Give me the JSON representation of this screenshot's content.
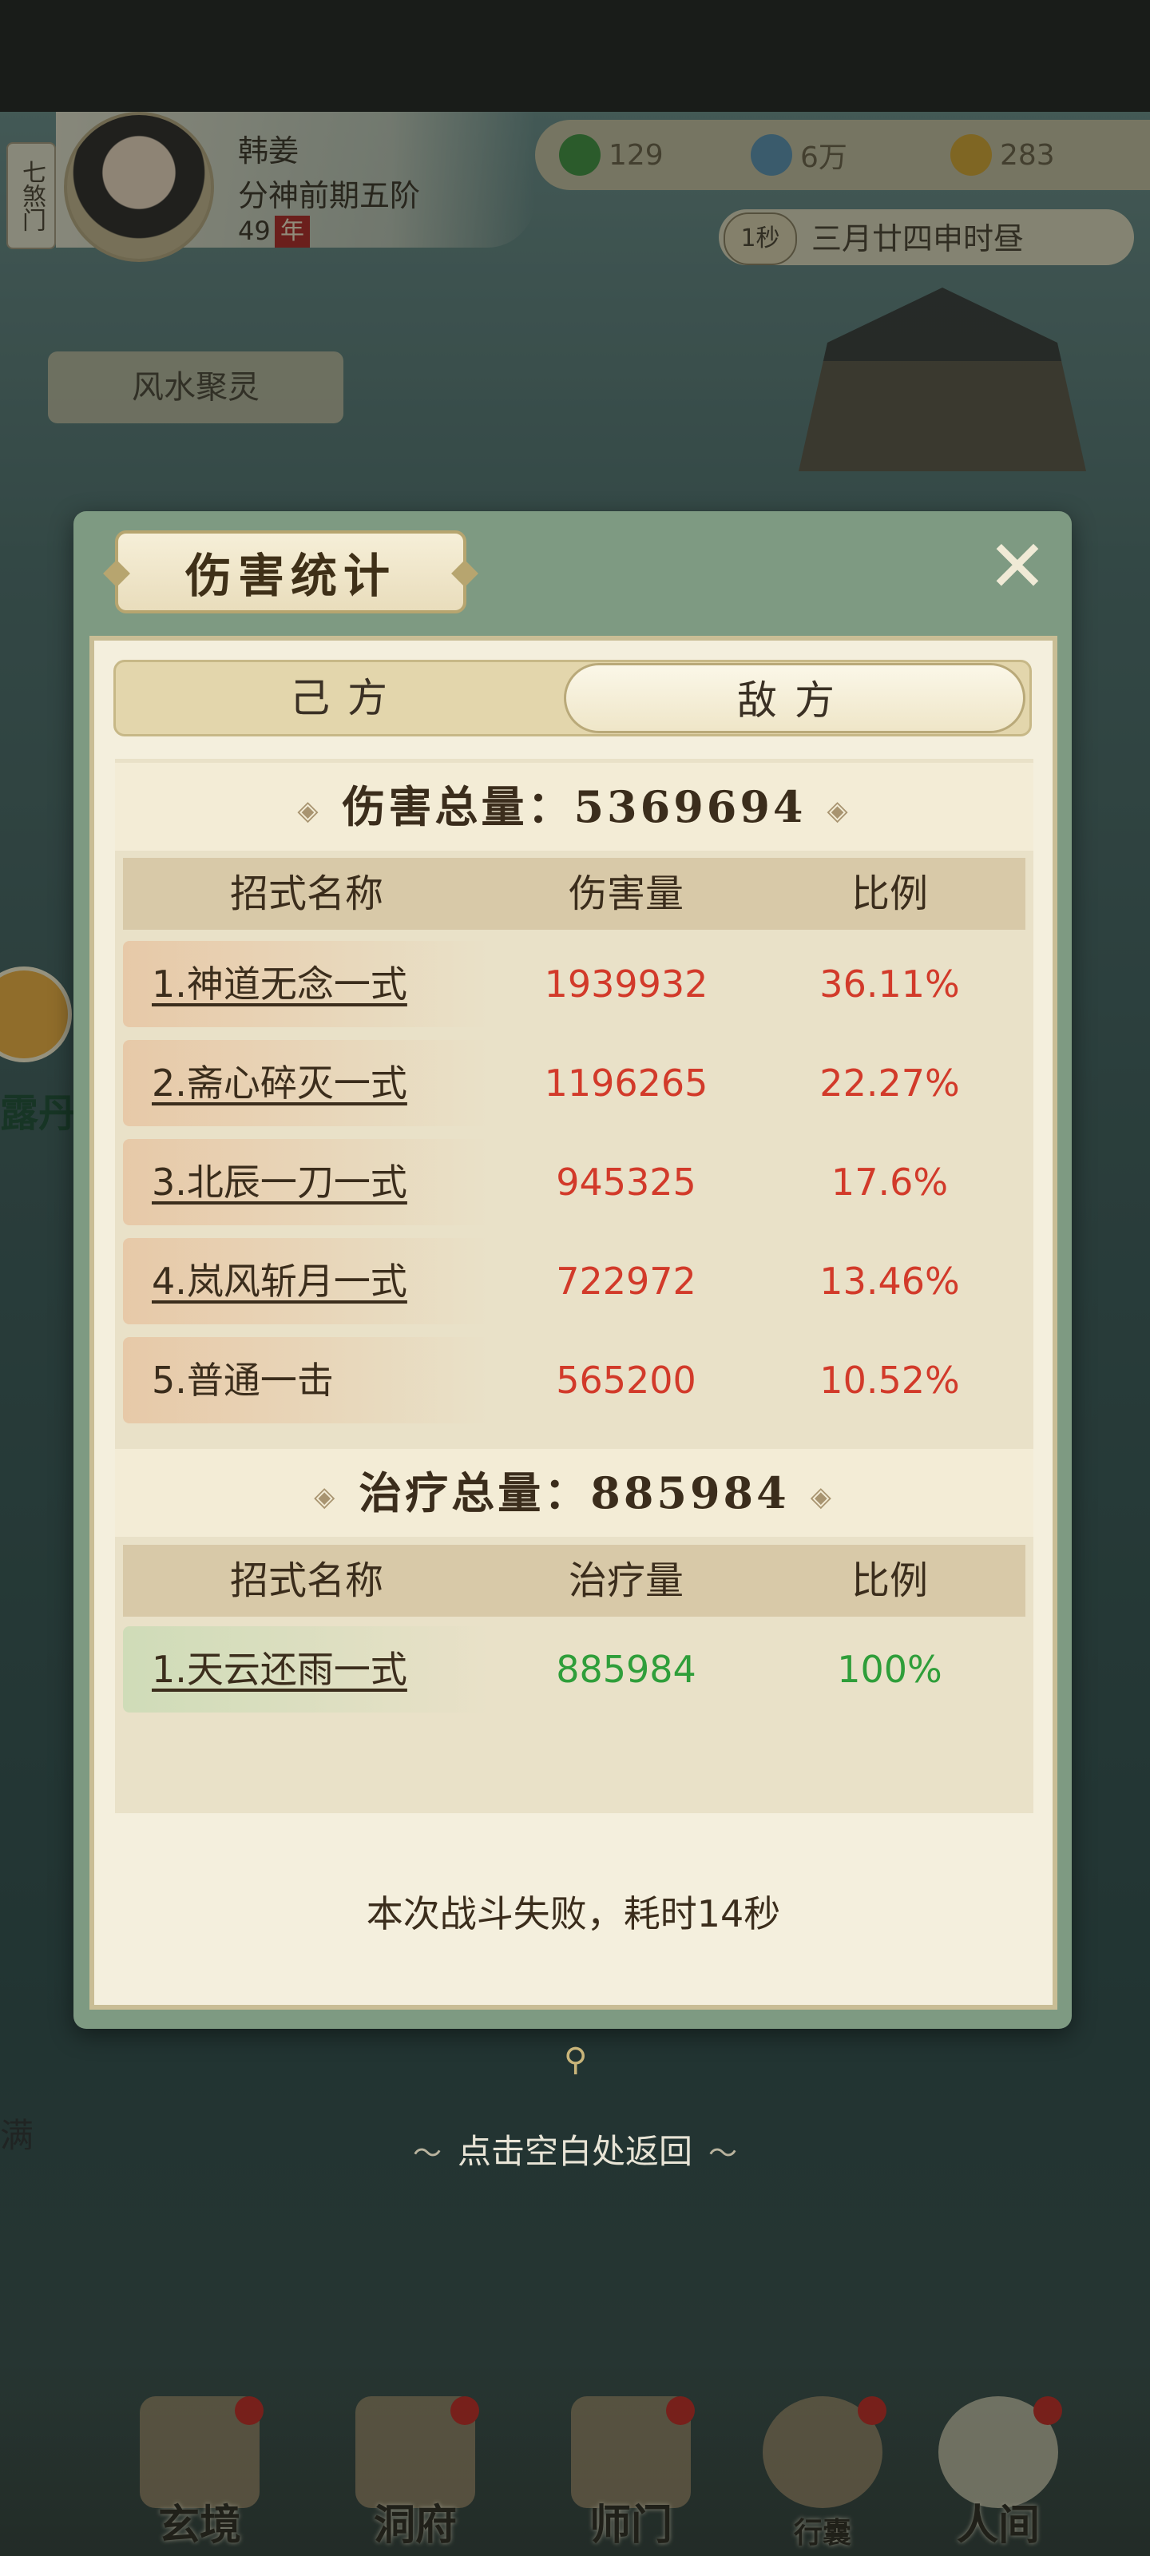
{
  "background": {
    "sect_tag": "七煞门",
    "player": {
      "name": "韩姜",
      "realm": "分神前期五阶",
      "age": "49",
      "age_badge": "年"
    },
    "resources": [
      {
        "icon": "jade-icon",
        "value": "129",
        "color": "#3f8f3a"
      },
      {
        "icon": "coin-icon",
        "value": "6万",
        "color": "#5a8fb0"
      },
      {
        "icon": "gold-icon",
        "value": "283",
        "color": "#d8a22a"
      }
    ],
    "time": {
      "speed": "1秒",
      "date": "三月廿四申时昼"
    },
    "fengshui_label": "风水聚灵",
    "side_label": "露丹",
    "side_label_lower": "满",
    "return_hint": "点击空白处返回",
    "nav": [
      {
        "label": "玄境",
        "icon": "scroll-icon"
      },
      {
        "label": "洞府",
        "icon": "pavilion-icon"
      },
      {
        "label": "师门",
        "icon": "banner-icon"
      },
      {
        "label": "行囊",
        "icon": "bag-icon"
      },
      {
        "label": "人间",
        "icon": "world-icon"
      }
    ]
  },
  "panel": {
    "title": "伤害统计",
    "close_icon": "close-icon",
    "tabs": {
      "ally": "己方",
      "enemy": "敌方",
      "active": "enemy"
    },
    "damage": {
      "header_label": "伤害总量：",
      "total": "5369694",
      "columns": {
        "name": "招式名称",
        "amount": "伤害量",
        "ratio": "比例"
      },
      "rows": [
        {
          "name": "1.神道无念一式",
          "amount": "1939932",
          "ratio": "36.11%"
        },
        {
          "name": "2.斋心碎灭一式",
          "amount": "1196265",
          "ratio": "22.27%"
        },
        {
          "name": "3.北辰一刀一式",
          "amount": "945325",
          "ratio": "17.6%"
        },
        {
          "name": "4.岚风斩月一式",
          "amount": "722972",
          "ratio": "13.46%"
        },
        {
          "name": "5.普通一击",
          "amount": "565200",
          "ratio": "10.52%"
        }
      ],
      "value_color": "#d23a2a",
      "row_bg": "#e7c9a8"
    },
    "healing": {
      "header_label": "治疗总量：",
      "total": "885984",
      "columns": {
        "name": "招式名称",
        "amount": "治疗量",
        "ratio": "比例"
      },
      "rows": [
        {
          "name": "1.天云还雨一式",
          "amount": "885984",
          "ratio": "100%"
        }
      ],
      "value_color": "#2f9e3a",
      "row_bg": "#cfdcb8"
    },
    "footer": "本次战斗失败，耗时14秒"
  }
}
